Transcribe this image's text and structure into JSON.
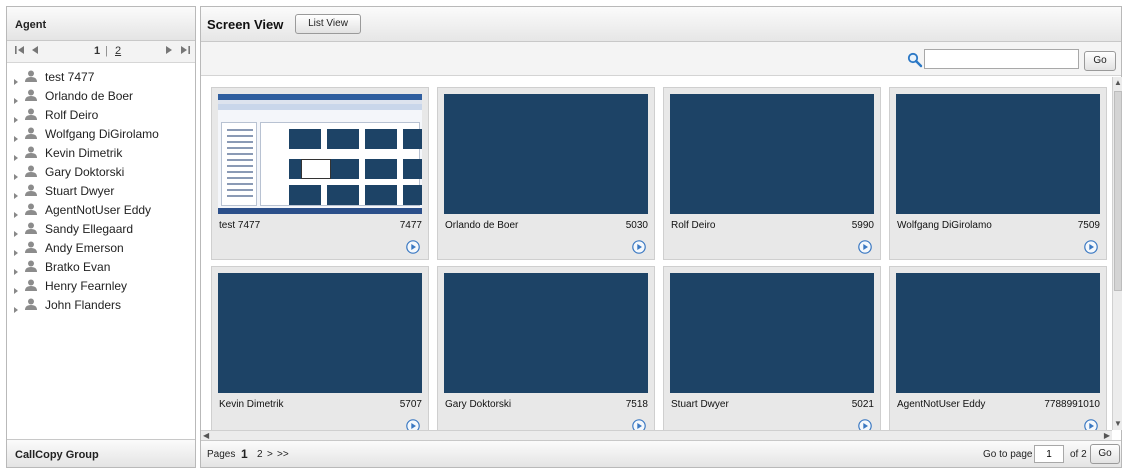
{
  "left_panel": {
    "title": "Agent",
    "pager": {
      "first": "⏮",
      "prev": "◀",
      "current": "1",
      "sep": "|",
      "next_page": "2",
      "next": "▶",
      "last": "⏭"
    },
    "agents": [
      "test 7477",
      "Orlando de Boer",
      "Rolf Deiro",
      "Wolfgang DiGirolamo",
      "Kevin Dimetrik",
      "Gary Doktorski",
      "Stuart Dwyer",
      "AgentNotUser Eddy",
      "Sandy Ellegaard",
      "Andy Emerson",
      "Bratko Evan",
      "Henry Fearnley",
      "John Flanders"
    ],
    "footer": "CallCopy Group"
  },
  "right_panel": {
    "title": "Screen View",
    "list_view_label": "List View",
    "search": {
      "value": "",
      "go_label": "Go"
    },
    "tiles": [
      {
        "name": "test 7477",
        "ext": "7477",
        "live": true
      },
      {
        "name": "Orlando de Boer",
        "ext": "5030",
        "live": false
      },
      {
        "name": "Rolf Deiro",
        "ext": "5990",
        "live": false
      },
      {
        "name": "Wolfgang DiGirolamo",
        "ext": "7509",
        "live": false
      },
      {
        "name": "Kevin Dimetrik",
        "ext": "5707",
        "live": false
      },
      {
        "name": "Gary Doktorski",
        "ext": "7518",
        "live": false
      },
      {
        "name": "Stuart Dwyer",
        "ext": "5021",
        "live": false
      },
      {
        "name": "AgentNotUser Eddy",
        "ext": "7788991010",
        "live": false
      }
    ],
    "footer": {
      "pages_label": "Pages",
      "page_current": "1",
      "page_other": "2",
      "next": ">",
      "last": ">>",
      "goto_label": "Go to page",
      "goto_value": "1",
      "of_label": "of 2",
      "go_label": "Go"
    }
  },
  "colors": {
    "thumb": "#1d4366",
    "play": "#3a78c2"
  }
}
